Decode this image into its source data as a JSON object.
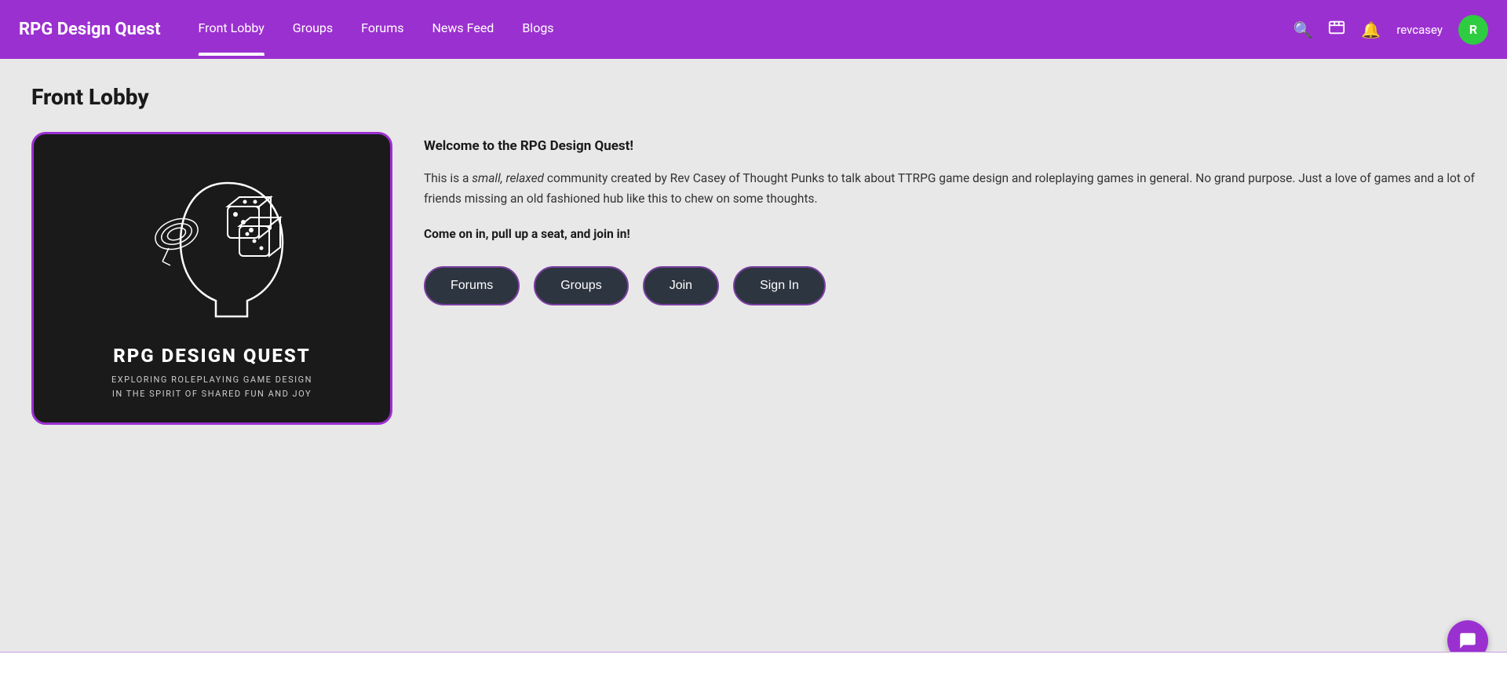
{
  "nav": {
    "logo": "RPG Design Quest",
    "links": [
      {
        "label": "Front Lobby",
        "active": true
      },
      {
        "label": "Groups",
        "active": false
      },
      {
        "label": "Forums",
        "active": false
      },
      {
        "label": "News Feed",
        "active": false
      },
      {
        "label": "Blogs",
        "active": false
      }
    ],
    "username": "revcasey",
    "avatar_letter": "R",
    "colors": {
      "bg": "#9b30d0",
      "avatar_bg": "#2ecc40"
    }
  },
  "page": {
    "title": "Front Lobby"
  },
  "logo_card": {
    "title": "RPG DESIGN QUEST",
    "subtitle_line1": "EXPLORING ROLEPLAYING GAME DESIGN",
    "subtitle_line2": "IN THE SPIRIT OF SHARED FUN AND JOY"
  },
  "content": {
    "welcome_heading": "Welcome to the RPG Design Quest!",
    "body": "This is a small, relaxed community created by Rev Casey of Thought Punks to talk about TTRPG game design and roleplaying games in general. No grand purpose. Just a love of games and a lot of friends missing an old fashioned hub like this to chew on some thoughts.",
    "cta": "Come on in, pull up a seat, and join in!"
  },
  "buttons": [
    {
      "label": "Forums",
      "name": "forums-button"
    },
    {
      "label": "Groups",
      "name": "groups-button"
    },
    {
      "label": "Join",
      "name": "join-button"
    },
    {
      "label": "Sign In",
      "name": "sign-in-button"
    }
  ]
}
